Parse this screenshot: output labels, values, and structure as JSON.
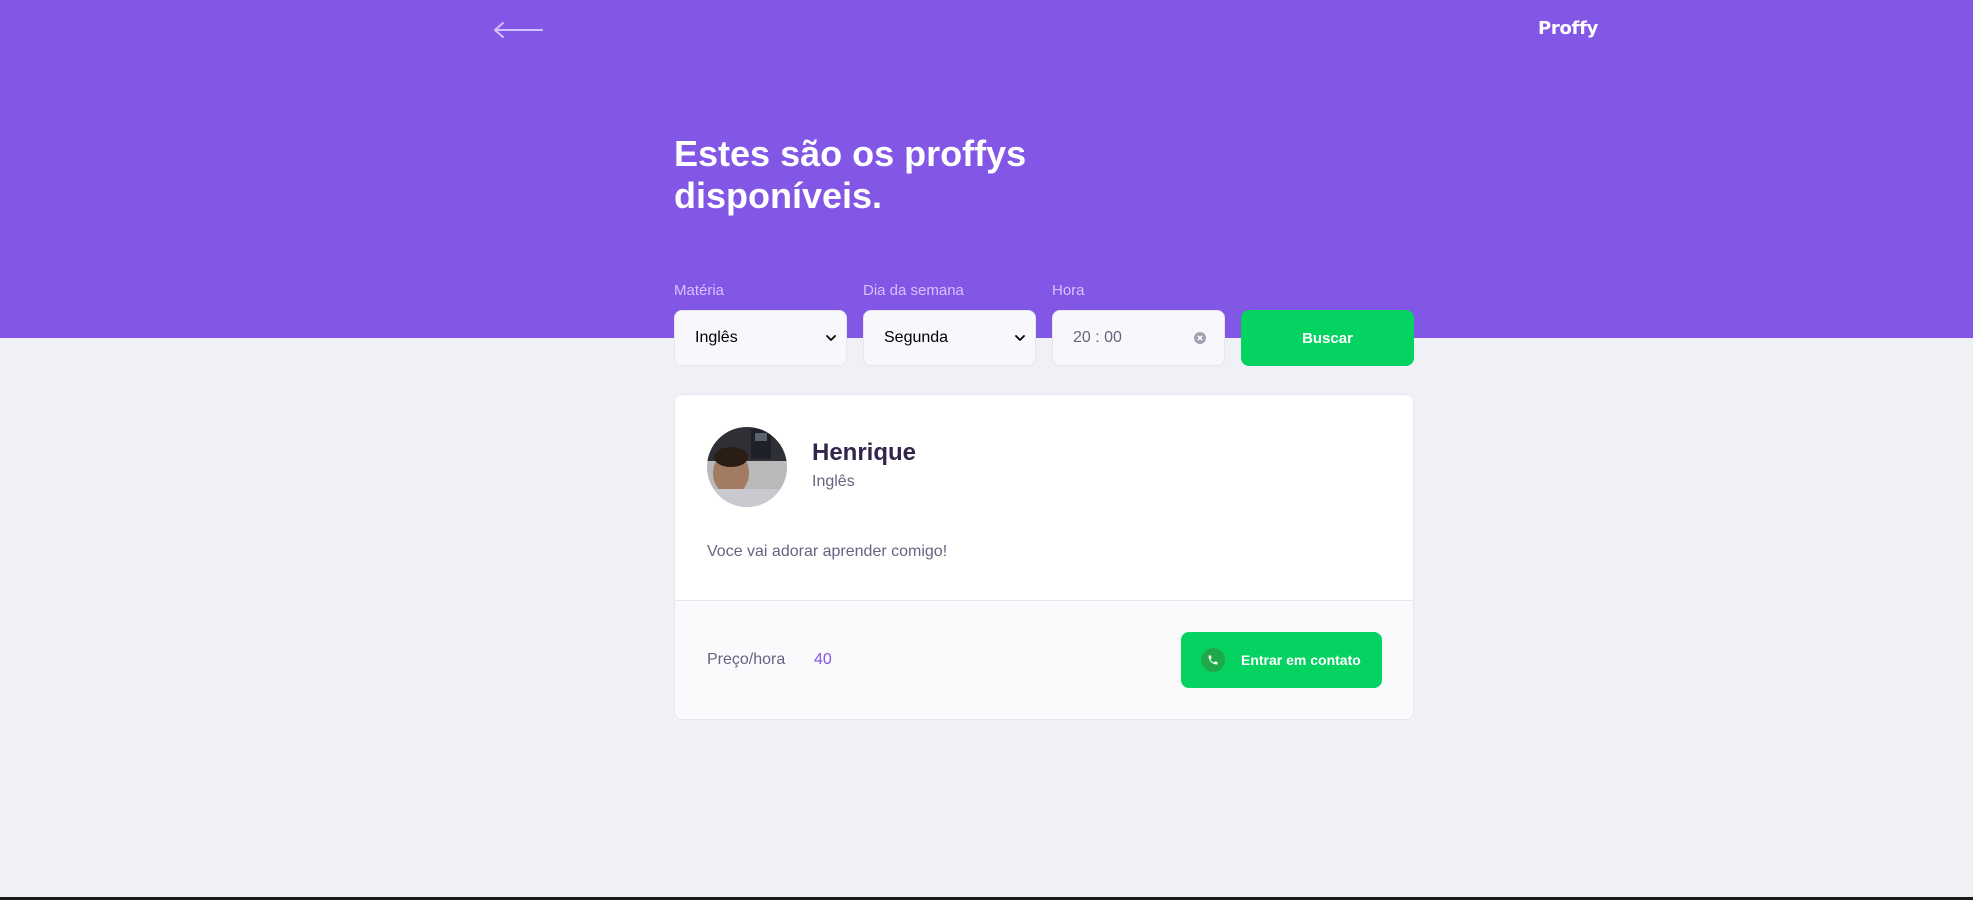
{
  "header": {
    "back_icon": "arrow-left-icon",
    "logo": "Proffy"
  },
  "hero": {
    "title": "Estes são os proffys disponíveis."
  },
  "filters": {
    "subject": {
      "label": "Matéria",
      "value": "Inglês"
    },
    "weekday": {
      "label": "Dia da semana",
      "value": "Segunda"
    },
    "time": {
      "label": "Hora",
      "value": "20 : 00"
    },
    "search_label": "Buscar"
  },
  "teacher": {
    "name": "Henrique",
    "subject": "Inglês",
    "bio": "Voce vai adorar aprender comigo!",
    "price_label": "Preço/hora",
    "price_value": "40",
    "contact_label": "Entrar em contato",
    "contact_icon": "whatsapp-phone-icon"
  },
  "colors": {
    "primary": "#8257E5",
    "background": "#F0F0F7",
    "accent_green": "#04D361",
    "title_text": "#32264D",
    "body_text": "#6A6180"
  }
}
